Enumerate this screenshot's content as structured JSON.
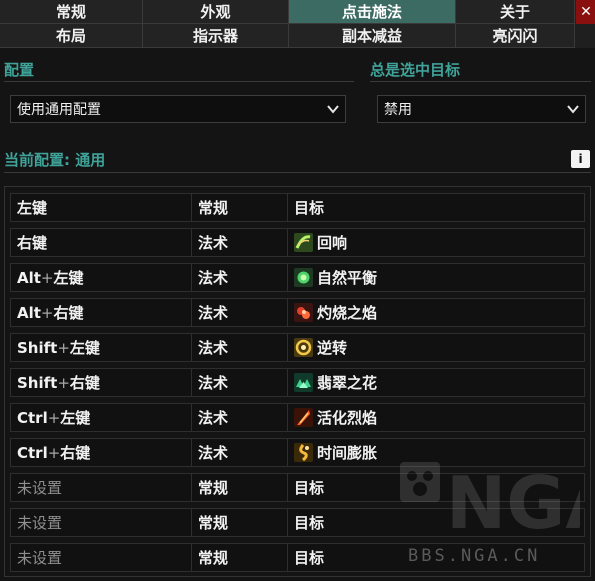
{
  "tabs_row1": [
    "常规",
    "外观",
    "点击施法",
    "关于"
  ],
  "tabs_row2": [
    "布局",
    "指示器",
    "副本减益",
    "亮闪闪"
  ],
  "active_tab": "点击施法",
  "close_symbol": "✕",
  "config": {
    "label": "配置",
    "dropdown_value": "使用通用配置"
  },
  "always_target": {
    "label": "总是选中目标",
    "dropdown_value": "禁用"
  },
  "current_config": {
    "label": "当前配置: 通用",
    "info_symbol": "i"
  },
  "bindings": [
    {
      "key": "左键",
      "modifier": "",
      "type": "常规",
      "action": "目标",
      "icon": null,
      "set": true
    },
    {
      "key": "右键",
      "modifier": "",
      "type": "法术",
      "action": "回响",
      "icon": "echo-icon",
      "set": true
    },
    {
      "key": "左键",
      "modifier": "Alt",
      "type": "法术",
      "action": "自然平衡",
      "icon": "nature-balance-icon",
      "set": true
    },
    {
      "key": "右键",
      "modifier": "Alt",
      "type": "法术",
      "action": "灼烧之焰",
      "icon": "scorching-flame-icon",
      "set": true
    },
    {
      "key": "左键",
      "modifier": "Shift",
      "type": "法术",
      "action": "逆转",
      "icon": "reversion-icon",
      "set": true
    },
    {
      "key": "右键",
      "modifier": "Shift",
      "type": "法术",
      "action": "翡翠之花",
      "icon": "emerald-blossom-icon",
      "set": true
    },
    {
      "key": "左键",
      "modifier": "Ctrl",
      "type": "法术",
      "action": "活化烈焰",
      "icon": "living-flame-icon",
      "set": true
    },
    {
      "key": "右键",
      "modifier": "Ctrl",
      "type": "法术",
      "action": "时间膨胀",
      "icon": "time-dilation-icon",
      "set": true
    },
    {
      "key": "未设置",
      "modifier": "",
      "type": "常规",
      "action": "目标",
      "icon": null,
      "set": false
    },
    {
      "key": "未设置",
      "modifier": "",
      "type": "常规",
      "action": "目标",
      "icon": null,
      "set": false
    },
    {
      "key": "未设置",
      "modifier": "",
      "type": "常规",
      "action": "目标",
      "icon": null,
      "set": false
    }
  ],
  "watermark": {
    "logo_text": "NGA",
    "url": "BBS.NGA.CN"
  },
  "colors": {
    "accent": "#3fa39a",
    "active_tab": "#3c6b63",
    "close": "#8a1010"
  }
}
